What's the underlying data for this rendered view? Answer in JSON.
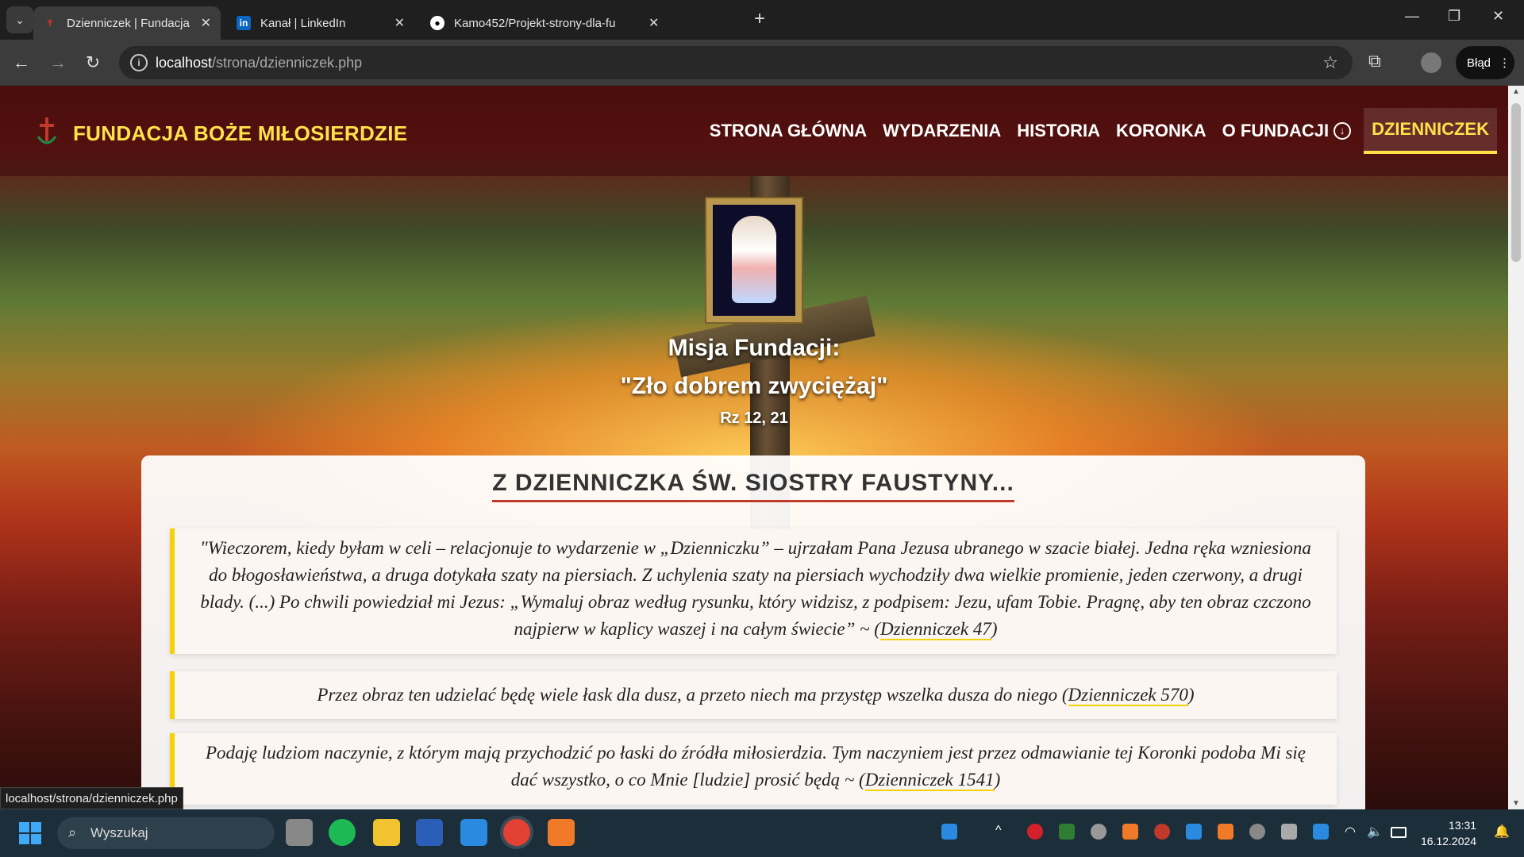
{
  "browser": {
    "tabs": [
      {
        "title": "Dzienniczek | Fundacja Boże Mi",
        "active": true
      },
      {
        "title": "Kanał | LinkedIn",
        "active": false
      },
      {
        "title": "Kamo452/Projekt-strony-dla-fu",
        "active": false
      }
    ],
    "address": {
      "host": "localhost",
      "path": "/strona/dzienniczek.php"
    },
    "error_button": "Błąd"
  },
  "site": {
    "brand": "FUNDACJA BOŻE MIŁOSIERDZIE",
    "nav": [
      {
        "label": "STRONA GŁÓWNA",
        "active": false
      },
      {
        "label": "WYDARZENIA",
        "active": false
      },
      {
        "label": "HISTORIA",
        "active": false
      },
      {
        "label": "KORONKA",
        "active": false
      },
      {
        "label": "O FUNDACJI",
        "active": false
      },
      {
        "label": "DZIENNICZEK",
        "active": true
      }
    ],
    "mission": {
      "line1": "Misja Fundacji:",
      "line2": "\"Zło dobrem zwyciężaj\"",
      "ref": "Rz 12, 21"
    },
    "card_title": "Z DZIENNICZKA ŚW. SIOSTRY FAUSTYNY...",
    "quotes": [
      {
        "text": "\"Wieczorem, kiedy byłam w celi – relacjonuje to wydarzenie w „Dzienniczku” – ujrzałam Pana Jezusa ubranego w szacie białej. Jedna ręka wzniesiona do błogosławieństwa, a druga dotykała szaty na piersiach. Z uchylenia szaty na piersiach wychodziły dwa wielkie promienie, jeden czerwony, a drugi blady. (...) Po chwili powiedział mi Jezus: „Wymaluj obraz według rysunku, który widzisz, z podpisem: Jezu, ufam Tobie. Pragnę, aby ten obraz czczono najpierw w kaplicy waszej i na całym świecie” ~ (",
        "ref": "Dzienniczek 47",
        "close": ")"
      },
      {
        "text": "Przez obraz ten udzielać będę wiele łask dla dusz, a przeto niech ma przystęp wszelka dusza do niego (",
        "ref": "Dzienniczek 570",
        "close": ")"
      },
      {
        "text": "Podaję ludziom naczynie, z którym mają przychodzić po łaski do źródła miłosierdzia. Tym naczyniem jest przez odmawianie tej Koronki podoba Mi się dać wszystko, o co Mnie [ludzie] prosić będą ~ (",
        "ref": "Dzienniczek 1541",
        "close": ")"
      }
    ]
  },
  "status_url": "localhost/strona/dzienniczek.php",
  "taskbar": {
    "search_placeholder": "Wyszukaj",
    "time": "13:31",
    "date": "16.12.2024"
  },
  "colors": {
    "accent": "#ffe14a",
    "title_underline": "#c0392b",
    "quote_border": "#f5d10a"
  }
}
